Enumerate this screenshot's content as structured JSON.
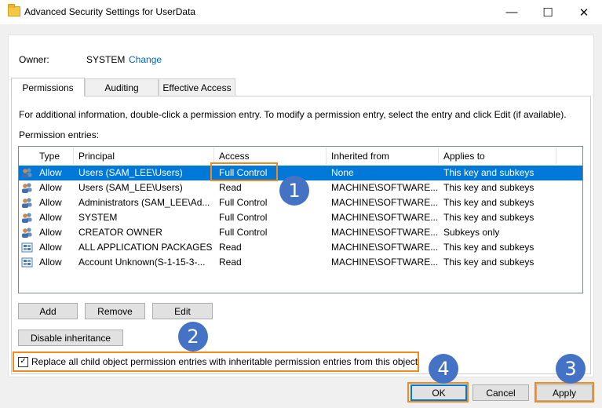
{
  "window": {
    "title": "Advanced Security Settings for UserData",
    "minimize_glyph": "—",
    "maximize_glyph": "☐",
    "close_glyph": "✕"
  },
  "owner": {
    "label": "Owner:",
    "value": "SYSTEM",
    "change": "Change"
  },
  "tabs": [
    {
      "label": "Permissions",
      "active": true
    },
    {
      "label": "Auditing",
      "active": false
    },
    {
      "label": "Effective Access",
      "active": false
    }
  ],
  "permissions": {
    "info": "For additional information, double-click a permission entry. To modify a permission entry, select the entry and click Edit (if available).",
    "entries_label": "Permission entries:",
    "columns": [
      "Type",
      "Principal",
      "Access",
      "Inherited from",
      "Applies to"
    ],
    "rows": [
      {
        "icon": "users-icon",
        "type": "Allow",
        "principal": "Users (SAM_LEE\\Users)",
        "access": "Full Control",
        "inherited": "None",
        "applies": "This key and subkeys",
        "selected": true
      },
      {
        "icon": "users-icon",
        "type": "Allow",
        "principal": "Users (SAM_LEE\\Users)",
        "access": "Read",
        "inherited": "MACHINE\\SOFTWARE...",
        "applies": "This key and subkeys",
        "selected": false
      },
      {
        "icon": "users-icon",
        "type": "Allow",
        "principal": "Administrators (SAM_LEE\\Ad...",
        "access": "Full Control",
        "inherited": "MACHINE\\SOFTWARE...",
        "applies": "This key and subkeys",
        "selected": false
      },
      {
        "icon": "users-icon",
        "type": "Allow",
        "principal": "SYSTEM",
        "access": "Full Control",
        "inherited": "MACHINE\\SOFTWARE...",
        "applies": "This key and subkeys",
        "selected": false
      },
      {
        "icon": "users-icon",
        "type": "Allow",
        "principal": "CREATOR OWNER",
        "access": "Full Control",
        "inherited": "MACHINE\\SOFTWARE...",
        "applies": "Subkeys only",
        "selected": false
      },
      {
        "icon": "package-icon",
        "type": "Allow",
        "principal": "ALL APPLICATION PACKAGES",
        "access": "Read",
        "inherited": "MACHINE\\SOFTWARE...",
        "applies": "This key and subkeys",
        "selected": false
      },
      {
        "icon": "package-icon",
        "type": "Allow",
        "principal": "Account Unknown(S-1-15-3-...",
        "access": "Read",
        "inherited": "MACHINE\\SOFTWARE...",
        "applies": "This key and subkeys",
        "selected": false
      }
    ],
    "buttons": {
      "add": "Add",
      "remove": "Remove",
      "edit": "Edit",
      "disable_inheritance": "Disable inheritance"
    },
    "replace_checkbox": {
      "label": "Replace all child object permission entries with inheritable permission entries from this object",
      "checked": true,
      "mark": "✓"
    }
  },
  "footer": {
    "ok": "OK",
    "cancel": "Cancel",
    "apply": "Apply"
  },
  "annotations": [
    "1",
    "2",
    "3",
    "4"
  ],
  "colors": {
    "selection": "#0078d7",
    "highlight": "#f08a1c",
    "badge": "#4472c4",
    "link": "#0066cc"
  }
}
